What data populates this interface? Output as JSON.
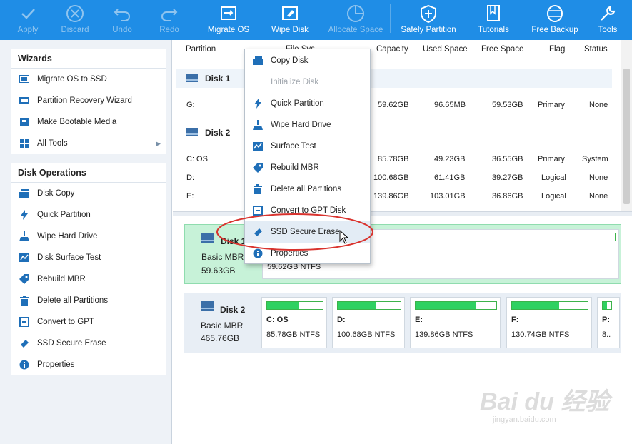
{
  "toolbar": {
    "apply": "Apply",
    "discard": "Discard",
    "undo": "Undo",
    "redo": "Redo",
    "migrate_os": "Migrate OS",
    "wipe_disk": "Wipe Disk",
    "allocate_space": "Allocate Space",
    "safely_partition": "Safely Partition",
    "tutorials": "Tutorials",
    "free_backup": "Free Backup",
    "tools": "Tools"
  },
  "wizards": {
    "title": "Wizards",
    "items": [
      "Migrate OS to SSD",
      "Partition Recovery Wizard",
      "Make Bootable Media",
      "All Tools"
    ]
  },
  "disk_ops": {
    "title": "Disk Operations",
    "items": [
      "Disk Copy",
      "Quick Partition",
      "Wipe Hard Drive",
      "Disk Surface Test",
      "Rebuild MBR",
      "Delete all Partitions",
      "Convert to GPT",
      "SSD Secure Erase",
      "Properties"
    ]
  },
  "table": {
    "headers": {
      "partition": "Partition",
      "fs": "File Sys",
      "capacity": "Capacity",
      "used": "Used Space",
      "free": "Free Space",
      "flag": "Flag",
      "status": "Status"
    },
    "disk1": "Disk 1",
    "disk2": "Disk 2",
    "rows": [
      {
        "partition": "G:",
        "capacity": "59.62GB",
        "used": "96.65MB",
        "free": "59.53GB",
        "flag": "Primary",
        "status": "None"
      },
      {
        "partition": "C: OS",
        "capacity": "85.78GB",
        "used": "49.23GB",
        "free": "36.55GB",
        "flag": "Primary",
        "status": "System"
      },
      {
        "partition": "D:",
        "capacity": "100.68GB",
        "used": "61.41GB",
        "free": "39.27GB",
        "flag": "Logical",
        "status": "None"
      },
      {
        "partition": "E:",
        "capacity": "139.86GB",
        "used": "103.01GB",
        "free": "36.86GB",
        "flag": "Logical",
        "status": "None"
      }
    ]
  },
  "diskmap": {
    "disk1": {
      "name": "Disk 1",
      "type": "Basic MBR",
      "size": "59.63GB",
      "part_size": "59.62GB NTFS"
    },
    "disk2": {
      "name": "Disk 2",
      "type": "Basic MBR",
      "size": "465.76GB",
      "parts": [
        {
          "name": "C: OS",
          "size": "85.78GB NTFS",
          "fill": 0.57
        },
        {
          "name": "D:",
          "size": "100.68GB NTFS",
          "fill": 0.61
        },
        {
          "name": "E:",
          "size": "139.86GB NTFS",
          "fill": 0.74
        },
        {
          "name": "F:",
          "size": "130.74GB NTFS",
          "fill": 0.62
        },
        {
          "name": "P:",
          "size": "8..",
          "fill": 0.5
        }
      ]
    }
  },
  "context_menu": {
    "items": [
      "Copy Disk",
      "Initialize Disk",
      "Quick Partition",
      "Wipe Hard Drive",
      "Surface Test",
      "Rebuild MBR",
      "Delete all Partitions",
      "Convert to GPT Disk",
      "SSD Secure Erase",
      "Properties"
    ]
  },
  "watermark": {
    "text": "Bai du 经验",
    "url": "jingyan.baidu.com"
  },
  "colors": {
    "toolbar": "#1f8de6",
    "bar_fill": "#2fd161",
    "highlight": "#d9332e"
  }
}
